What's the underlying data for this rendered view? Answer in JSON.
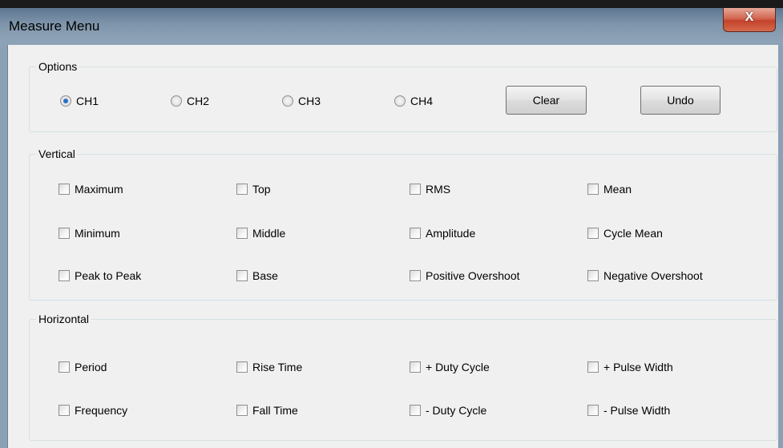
{
  "window": {
    "title": "Measure Menu",
    "close_glyph": "X"
  },
  "options": {
    "legend": "Options",
    "channels": [
      {
        "label": "CH1",
        "checked": true
      },
      {
        "label": "CH2",
        "checked": false
      },
      {
        "label": "CH3",
        "checked": false
      },
      {
        "label": "CH4",
        "checked": false
      }
    ],
    "clear_label": "Clear",
    "undo_label": "Undo"
  },
  "vertical": {
    "legend": "Vertical",
    "items": [
      "Maximum",
      "Top",
      "RMS",
      "Mean",
      "Minimum",
      "Middle",
      "Amplitude",
      "Cycle Mean",
      "Peak to Peak",
      "Base",
      "Positive Overshoot",
      "Negative Overshoot"
    ]
  },
  "horizontal": {
    "legend": "Horizontal",
    "items": [
      "Period",
      "Rise Time",
      "+ Duty Cycle",
      "+ Pulse Width",
      "Frequency",
      "Fall Time",
      "- Duty Cycle",
      "- Pulse Width"
    ]
  }
}
